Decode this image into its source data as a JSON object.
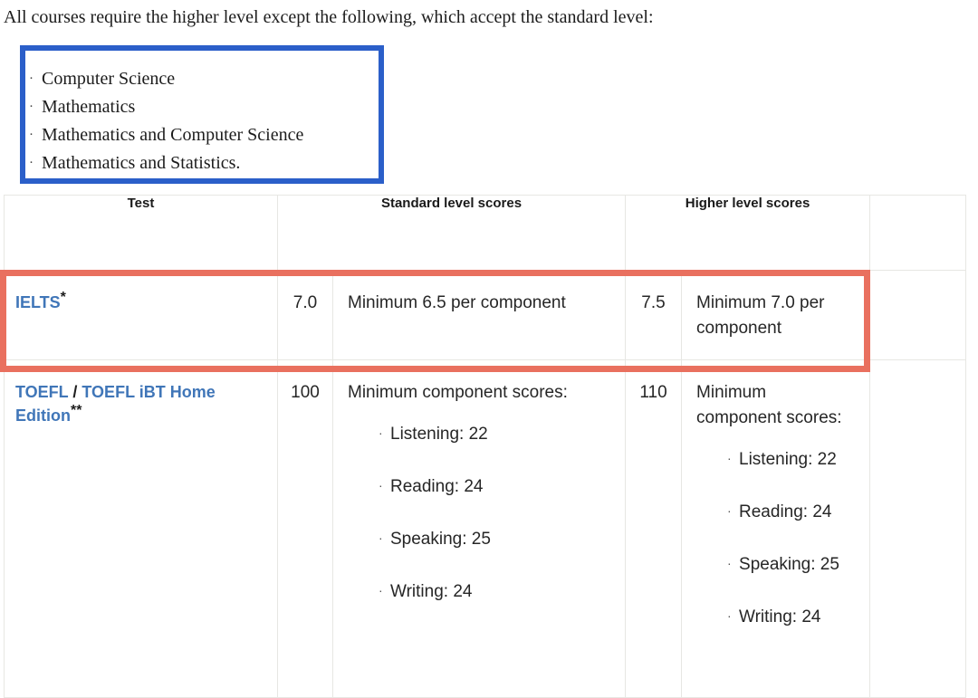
{
  "intro": {
    "text": "All courses require the higher level except the following, which accept the standard level:"
  },
  "course_list": {
    "bullet": "·",
    "items": [
      "Computer Science",
      "Mathematics",
      "Mathematics and Computer Science",
      "Mathematics and Statistics."
    ]
  },
  "annotations": {
    "blue_box": {
      "color": "#2b5fc9",
      "target": "course-list"
    },
    "red_box": {
      "color": "#e9705f",
      "target": "ielts-row"
    }
  },
  "table": {
    "headers": {
      "test": "Test",
      "standard": "Standard level scores",
      "higher": "Higher level scores",
      "tail": ""
    },
    "rows": [
      {
        "id": "ielts",
        "test": {
          "links": [
            "IELTS"
          ],
          "separator": "",
          "suffix": "",
          "marker": "*"
        },
        "standard_score": "7.0",
        "standard_text": "Minimum 6.5 per component",
        "standard_bullets": [],
        "higher_score": "7.5",
        "higher_text": "Minimum 7.0 per component",
        "higher_bullets": []
      },
      {
        "id": "toefl",
        "test": {
          "links": [
            "TOEFL",
            "TOEFL iBT Home Edition"
          ],
          "separator": "/",
          "suffix": "",
          "marker": "**"
        },
        "standard_score": "100",
        "standard_text": "Minimum component scores:",
        "standard_bullets": [
          "Listening: 22",
          "Reading: 24",
          "Speaking: 25",
          "Writing: 24"
        ],
        "higher_score": "110",
        "higher_text": "Minimum component scores:",
        "higher_bullets": [
          "Listening: 22",
          "Reading: 24",
          "Speaking: 25",
          "Writing: 24"
        ]
      }
    ],
    "bullet": "·"
  },
  "colors": {
    "link": "#4076b8",
    "annotation_blue": "#2b5fc9",
    "annotation_red": "#e9705f",
    "table_border": "#e7e7e3"
  }
}
